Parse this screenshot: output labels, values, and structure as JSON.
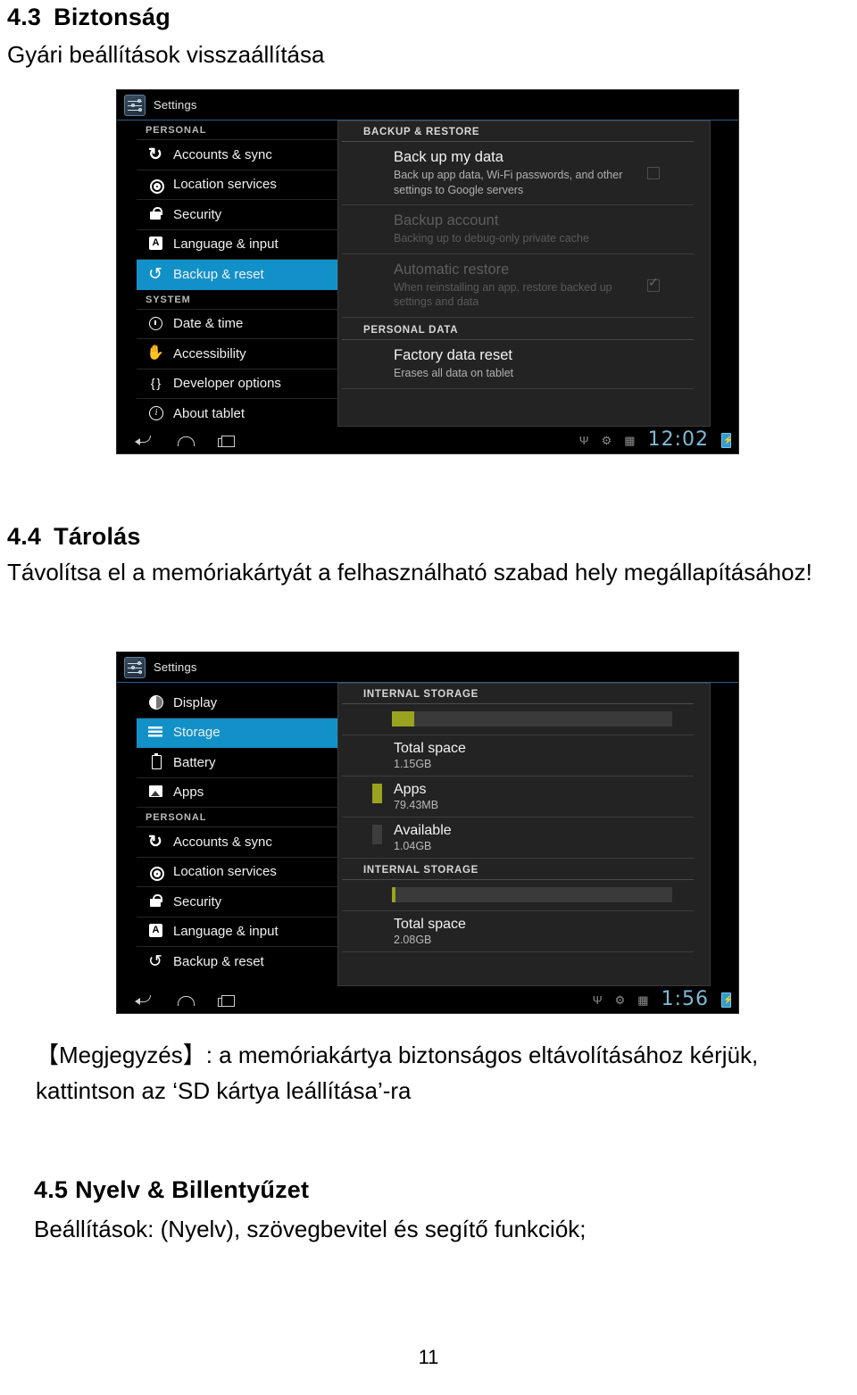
{
  "document": {
    "section_43": {
      "number": "4.3",
      "title": "Biztonság",
      "subtitle": "Gyári beállítások visszaállítása"
    },
    "section_44": {
      "number": "4.4",
      "title": "Tárolás",
      "body": "Távolítsa el a memóriakártyát a felhasználható szabad hely megállapításához!"
    },
    "note": "【Megjegyzés】: a memóriakártya biztonságos eltávolításához kérjük, kattintson az ‘SD kártya leállítása’-ra",
    "section_45": {
      "number": "4.5",
      "title": "Nyelv & Billentyűzet",
      "body": "Beállítások: (Nyelv), szövegbevitel és segítő funkciók;"
    },
    "page_number": "11"
  },
  "colors": {
    "accent_selected": "#1191c8",
    "storage_fill": "#9aa320",
    "clock": "#7fb8d6",
    "panel_bg": "#232323"
  },
  "screenshot_backup": {
    "app_title": "Settings",
    "app_icon": "settings-sliders-icon",
    "nav": [
      {
        "type": "group",
        "label": "PERSONAL"
      },
      {
        "type": "item",
        "label": "Accounts & sync",
        "icon": "sync-icon",
        "selected": false
      },
      {
        "type": "item",
        "label": "Location services",
        "icon": "location-icon",
        "selected": false
      },
      {
        "type": "item",
        "label": "Security",
        "icon": "lock-icon",
        "selected": false
      },
      {
        "type": "item",
        "label": "Language & input",
        "icon": "language-icon",
        "selected": false
      },
      {
        "type": "item",
        "label": "Backup & reset",
        "icon": "backup-reset-icon",
        "selected": true
      },
      {
        "type": "group",
        "label": "SYSTEM"
      },
      {
        "type": "item",
        "label": "Date & time",
        "icon": "clock-icon",
        "selected": false
      },
      {
        "type": "item",
        "label": "Accessibility",
        "icon": "hand-icon",
        "selected": false
      },
      {
        "type": "item",
        "label": "Developer options",
        "icon": "braces-icon",
        "selected": false
      },
      {
        "type": "item",
        "label": "About tablet",
        "icon": "info-icon",
        "selected": false
      }
    ],
    "content": {
      "header_backup": "BACKUP & RESTORE",
      "rows": [
        {
          "title": "Back up my data",
          "subtitle": "Back up app data, Wi-Fi passwords, and other settings to Google servers",
          "dimmed": false,
          "checkbox": "unchecked"
        },
        {
          "title": "Backup account",
          "subtitle": "Backing up to debug-only private cache",
          "dimmed": true,
          "checkbox": "none"
        },
        {
          "title": "Automatic restore",
          "subtitle": "When reinstalling an app, restore backed up settings and data",
          "dimmed": true,
          "checkbox": "checked"
        }
      ],
      "header_personal": "PERSONAL DATA",
      "factory": {
        "title": "Factory data reset",
        "subtitle": "Erases all data on tablet"
      }
    },
    "systembar": {
      "back": "back-icon",
      "home": "home-icon",
      "recents": "recents-icon",
      "usb": "usb-icon",
      "debug": "android-debug-icon",
      "sd": "sd-card-icon",
      "clock": "12:02",
      "battery": "battery-charging-icon"
    }
  },
  "screenshot_storage": {
    "app_title": "Settings",
    "app_icon": "settings-sliders-icon",
    "nav": [
      {
        "type": "item",
        "label": "Display",
        "icon": "display-icon",
        "selected": false
      },
      {
        "type": "item",
        "label": "Storage",
        "icon": "storage-icon",
        "selected": true
      },
      {
        "type": "item",
        "label": "Battery",
        "icon": "battery-icon",
        "selected": false
      },
      {
        "type": "item",
        "label": "Apps",
        "icon": "apps-icon",
        "selected": false
      },
      {
        "type": "group",
        "label": "PERSONAL"
      },
      {
        "type": "item",
        "label": "Accounts & sync",
        "icon": "sync-icon",
        "selected": false
      },
      {
        "type": "item",
        "label": "Location services",
        "icon": "location-icon",
        "selected": false
      },
      {
        "type": "item",
        "label": "Security",
        "icon": "lock-icon",
        "selected": false
      },
      {
        "type": "item",
        "label": "Language & input",
        "icon": "language-icon",
        "selected": false
      },
      {
        "type": "item",
        "label": "Backup & reset",
        "icon": "backup-reset-icon",
        "selected": false
      }
    ],
    "content": {
      "block1": {
        "header": "INTERNAL STORAGE",
        "bar_percent": 8,
        "total_label": "Total space",
        "total_value": "1.15GB",
        "items": [
          {
            "name": "Apps",
            "value": "79.43MB",
            "color": "#9aa320"
          },
          {
            "name": "Available",
            "value": "1.04GB",
            "color": "#3d3d3d"
          }
        ]
      },
      "block2": {
        "header": "INTERNAL STORAGE",
        "bar_percent": 1.2,
        "total_label": "Total space",
        "total_value": "2.08GB"
      }
    },
    "systembar": {
      "clock": "1:56",
      "usb": "usb-icon",
      "debug": "android-debug-icon",
      "sd": "sd-card-icon",
      "battery": "battery-charging-icon"
    }
  }
}
